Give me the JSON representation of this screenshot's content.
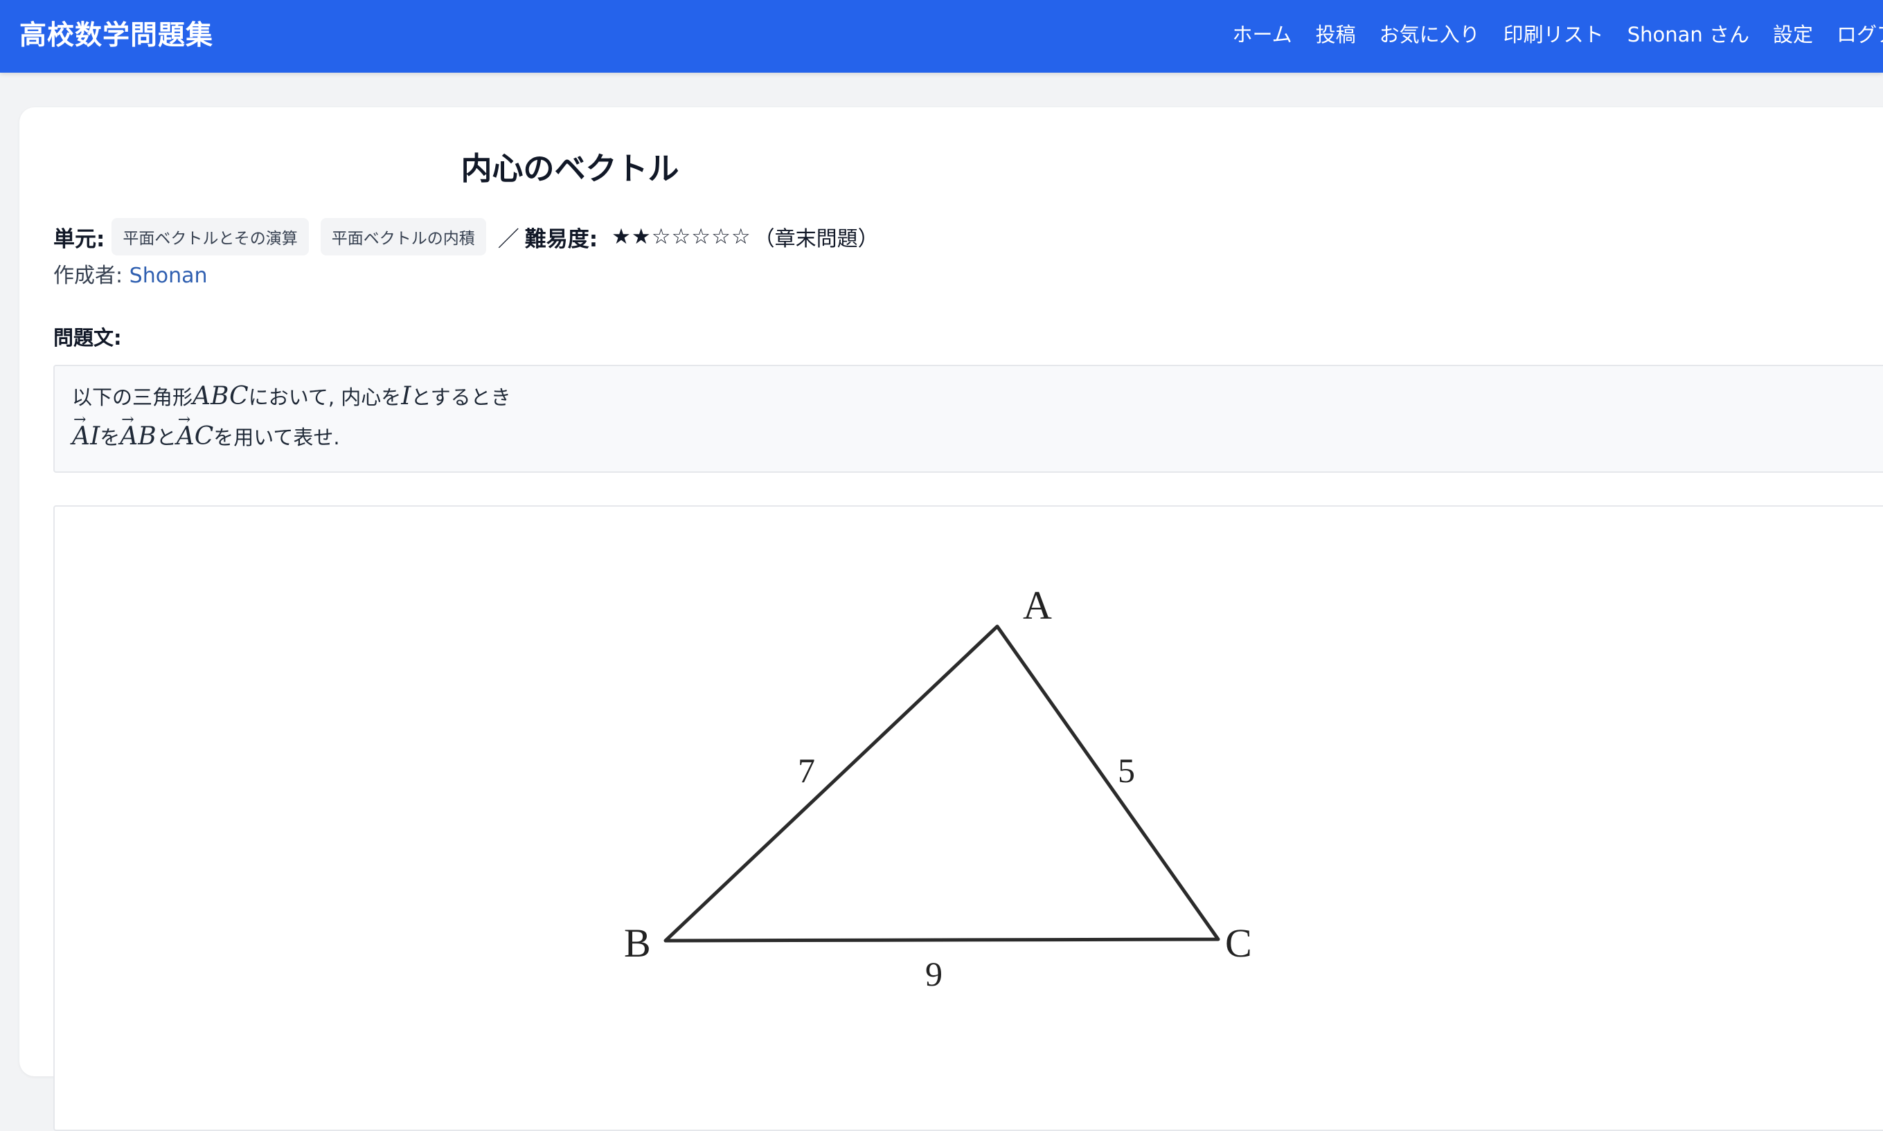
{
  "header": {
    "brand": "高校数学問題集",
    "nav": [
      "ホーム",
      "投稿",
      "お気に入り",
      "印刷リスト",
      "Shonan さん",
      "設定",
      "ログア"
    ]
  },
  "problem": {
    "title": "内心のベクトル",
    "unit_label": "単元:",
    "tags": [
      "平面ベクトルとその演算",
      "平面ベクトルの内積"
    ],
    "separator": "／",
    "difficulty_label": "難易度:",
    "stars": "★★☆☆☆☆☆",
    "level": "（章末問題）",
    "author_label": "作成者:",
    "author": "Shonan",
    "section_label": "問題文:",
    "text": {
      "part1": "以下の三角形",
      "math_abc": "ABC",
      "part2": "において, 内心を",
      "math_i": "I",
      "part3": "とするとき",
      "vec_ai": "AI",
      "part4": "を",
      "vec_ab": "AB",
      "part5": "と",
      "vec_ac": "AC",
      "part6": "を用いて表せ."
    }
  },
  "figure": {
    "vertices": {
      "A": "A",
      "B": "B",
      "C": "C"
    },
    "sides": {
      "AB": "7",
      "AC": "5",
      "BC": "9"
    }
  }
}
